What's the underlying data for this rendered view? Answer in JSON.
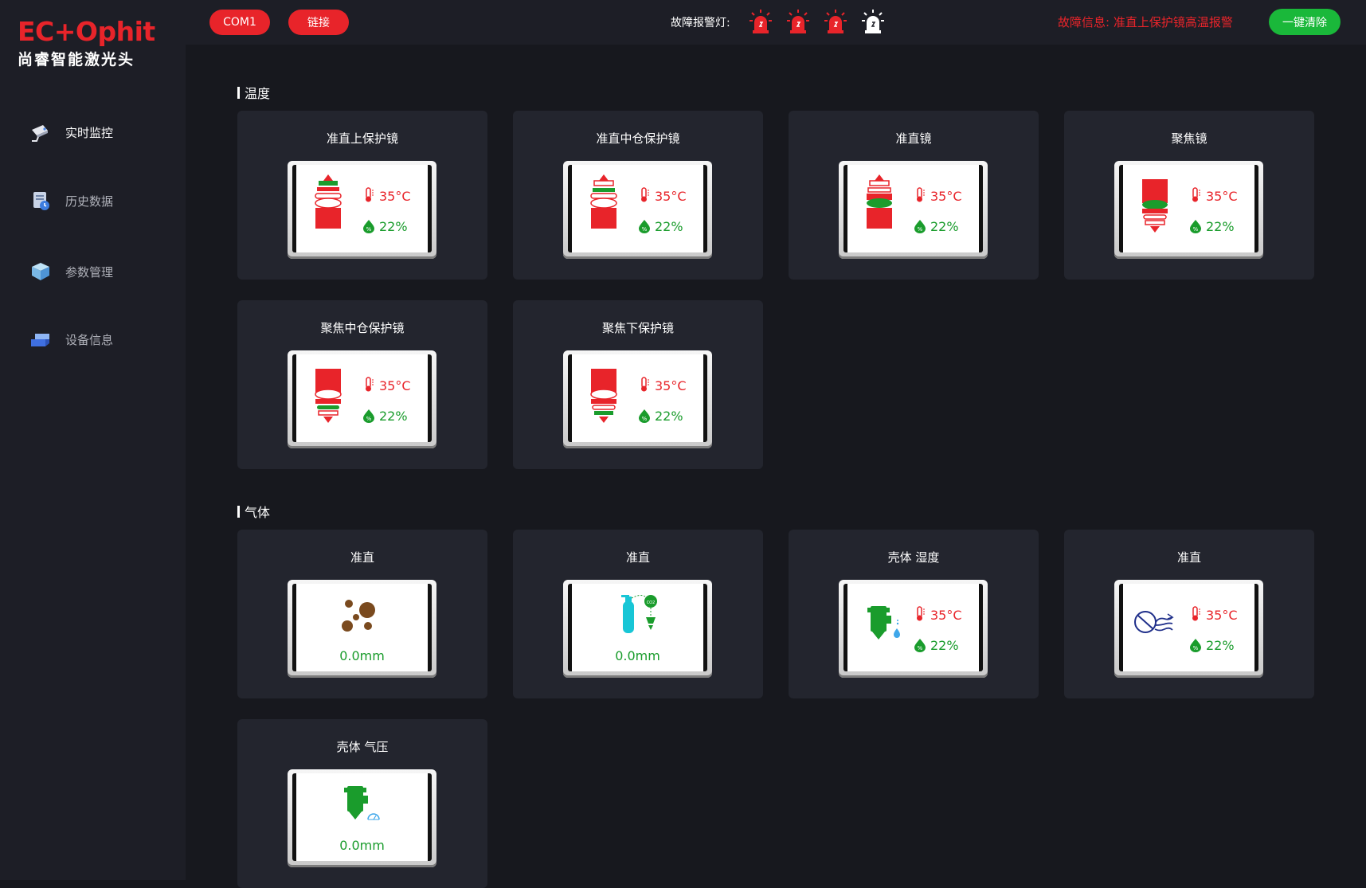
{
  "brand": {
    "name": "EC+Ophit",
    "subtitle": "尚睿智能激光头"
  },
  "sidebar": {
    "items": [
      {
        "label": "实时监控",
        "icon": "camera-icon",
        "active": true
      },
      {
        "label": "历史数据",
        "icon": "history-icon",
        "active": false
      },
      {
        "label": "参数管理",
        "icon": "cube-icon",
        "active": false
      },
      {
        "label": "设备信息",
        "icon": "device-icon",
        "active": false
      }
    ]
  },
  "header": {
    "com_label": "COM1",
    "link_label": "链接",
    "alarm_label": "故障报警灯:",
    "lamps": [
      {
        "color": "#e8242a",
        "icon": "alarm-lamp-icon"
      },
      {
        "color": "#e8242a",
        "icon": "alarm-lamp-icon"
      },
      {
        "color": "#e8242a",
        "icon": "alarm-lamp-icon"
      },
      {
        "color": "#ffffff",
        "icon": "alarm-lamp-icon"
      }
    ],
    "fault_info": "故障信息: 准直上保护镜高温报警",
    "clear_label": "一键清除"
  },
  "sections": {
    "temperature": {
      "title": "温度"
    },
    "gas": {
      "title": "气体"
    }
  },
  "temperature_cards": [
    {
      "title": "准直上保护镜",
      "temp": "35°C",
      "humidity": "22%",
      "icon": "collimator-top-lens-icon"
    },
    {
      "title": "准直中仓保护镜",
      "temp": "35°C",
      "humidity": "22%",
      "icon": "collimator-mid-lens-icon"
    },
    {
      "title": "准直镜",
      "temp": "35°C",
      "humidity": "22%",
      "icon": "collimator-lens-icon"
    },
    {
      "title": "聚焦镜",
      "temp": "35°C",
      "humidity": "22%",
      "icon": "focus-lens-icon"
    },
    {
      "title": "聚焦中仓保护镜",
      "temp": "35°C",
      "humidity": "22%",
      "icon": "focus-mid-lens-icon"
    },
    {
      "title": "聚焦下保护镜",
      "temp": "35°C",
      "humidity": "22%",
      "icon": "focus-bottom-lens-icon"
    }
  ],
  "gas_cards": [
    {
      "title": "准直",
      "value": "0.0mm",
      "icon": "dust-particles-icon"
    },
    {
      "title": "准直",
      "value": "0.0mm",
      "icon": "gas-cylinder-icon"
    },
    {
      "title": "壳体 湿度",
      "temp": "35°C",
      "humidity": "22%",
      "icon": "housing-humidity-icon"
    },
    {
      "title": "准直",
      "temp": "35°C",
      "humidity": "22%",
      "icon": "fan-airflow-icon"
    },
    {
      "title": "壳体 气压",
      "value": "0.0mm",
      "icon": "housing-pressure-icon"
    }
  ],
  "colors": {
    "accent_red": "#e8242a",
    "accent_green": "#1ab83a",
    "lens_green": "#1a9c2c",
    "background": "#17181e",
    "card": "#23252e"
  }
}
